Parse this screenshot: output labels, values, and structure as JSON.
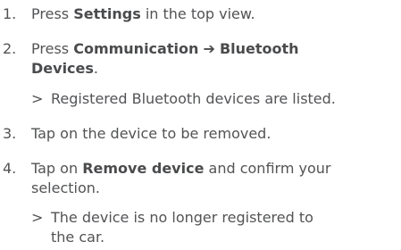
{
  "steps": [
    {
      "num": "1.",
      "pre": "Press ",
      "bold": "Settings",
      "post": " in the top view."
    },
    {
      "num": "2.",
      "pre": "Press ",
      "bold1": "Communication",
      "arrow": "➔",
      "bold2": "Bluetooth",
      "bold3": "Devices",
      "post": "."
    },
    {
      "num": "3.",
      "text": "Tap on the device to be removed."
    },
    {
      "num": "4.",
      "pre": "Tap on ",
      "bold": "Remove device",
      "post": " and confirm your",
      "line2": "selection."
    }
  ],
  "results": [
    {
      "chevron": ">",
      "text": "Registered Bluetooth devices are listed."
    },
    {
      "chevron": ">",
      "line1": "The device is no longer registered to",
      "line2": "the car."
    }
  ]
}
